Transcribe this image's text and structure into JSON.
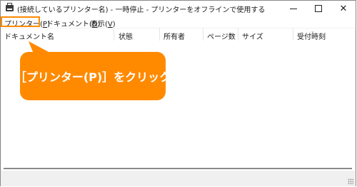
{
  "window": {
    "title": "(接続しているプリンター名) - 一時停止 - プリンターをオフラインで使用する",
    "close_glyph": "✕"
  },
  "menu": {
    "printer_label": "プリンター(",
    "printer_key": "P",
    "printer_end": ")",
    "document_label": "ドキュメント(",
    "document_key": "D",
    "document_end": ")",
    "view_label": "表示(",
    "view_key": "V",
    "view_end": ")"
  },
  "columns": [
    "ドキュメント名",
    "状態",
    "所有者",
    "ページ数",
    "サイズ",
    "受付時刻"
  ],
  "callout": {
    "text": "［プリンター(P)］をクリック"
  },
  "colors": {
    "accent": "#ff8a00"
  }
}
